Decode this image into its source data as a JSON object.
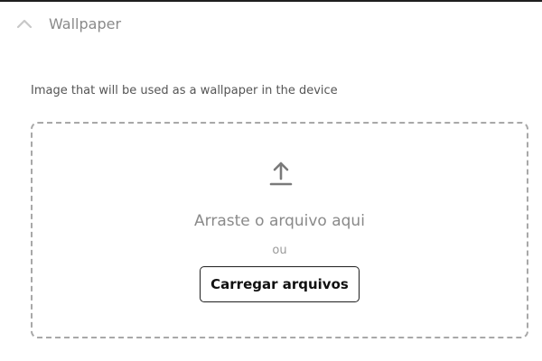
{
  "section": {
    "title": "Wallpaper",
    "expanded": true,
    "description": "Image that will be used as a wallpaper in the device"
  },
  "dropzone": {
    "drop_text": "Arraste o arquivo aqui",
    "or_text": "ou",
    "button_label": "Carregar arquivos"
  },
  "colors": {
    "border": "#a8a8a8",
    "muted_text": "#8a8a8a",
    "button_border": "#1f1f1f"
  },
  "icons": {
    "collapse": "chevron-up-icon",
    "upload": "upload-icon"
  }
}
